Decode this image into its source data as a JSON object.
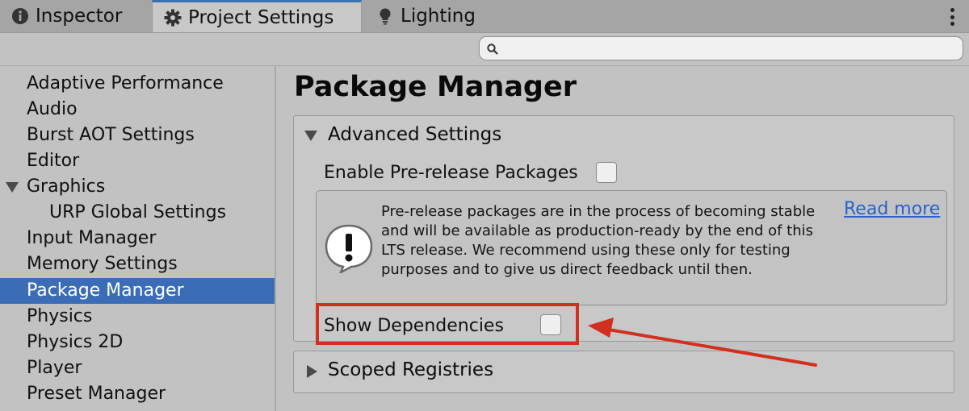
{
  "tabs": [
    {
      "label": "Inspector",
      "icon": "info-icon",
      "active": false
    },
    {
      "label": "Project Settings",
      "icon": "gear-icon",
      "active": true
    },
    {
      "label": "Lighting",
      "icon": "lightbulb-icon",
      "active": false
    }
  ],
  "search": {
    "value": "",
    "placeholder": ""
  },
  "sidebar": {
    "items": [
      {
        "label": "Adaptive Performance"
      },
      {
        "label": "Audio"
      },
      {
        "label": "Burst AOT Settings"
      },
      {
        "label": "Editor"
      },
      {
        "label": "Graphics",
        "expanded": true
      },
      {
        "label": "URP Global Settings",
        "indent": 1
      },
      {
        "label": "Input Manager"
      },
      {
        "label": "Memory Settings"
      },
      {
        "label": "Package Manager",
        "selected": true
      },
      {
        "label": "Physics"
      },
      {
        "label": "Physics 2D"
      },
      {
        "label": "Player"
      },
      {
        "label": "Preset Manager"
      }
    ]
  },
  "main": {
    "title": "Package Manager",
    "advanced": {
      "header": "Advanced Settings",
      "expanded": true,
      "prerelease_label": "Enable Pre-release Packages",
      "prerelease_checked": false,
      "help_text": "Pre-release packages are in the process of becoming stable and will be available as production-ready by the end of this LTS release. We recommend using these only for testing purposes and to give us direct feedback until then.",
      "read_more": "Read more",
      "show_deps_label": "Show Dependencies",
      "show_deps_checked": false
    },
    "scoped": {
      "header": "Scoped Registries",
      "expanded": false
    }
  },
  "colors": {
    "selection": "#3a6db5",
    "annotation": "#d2301e",
    "link": "#2a63c8"
  }
}
